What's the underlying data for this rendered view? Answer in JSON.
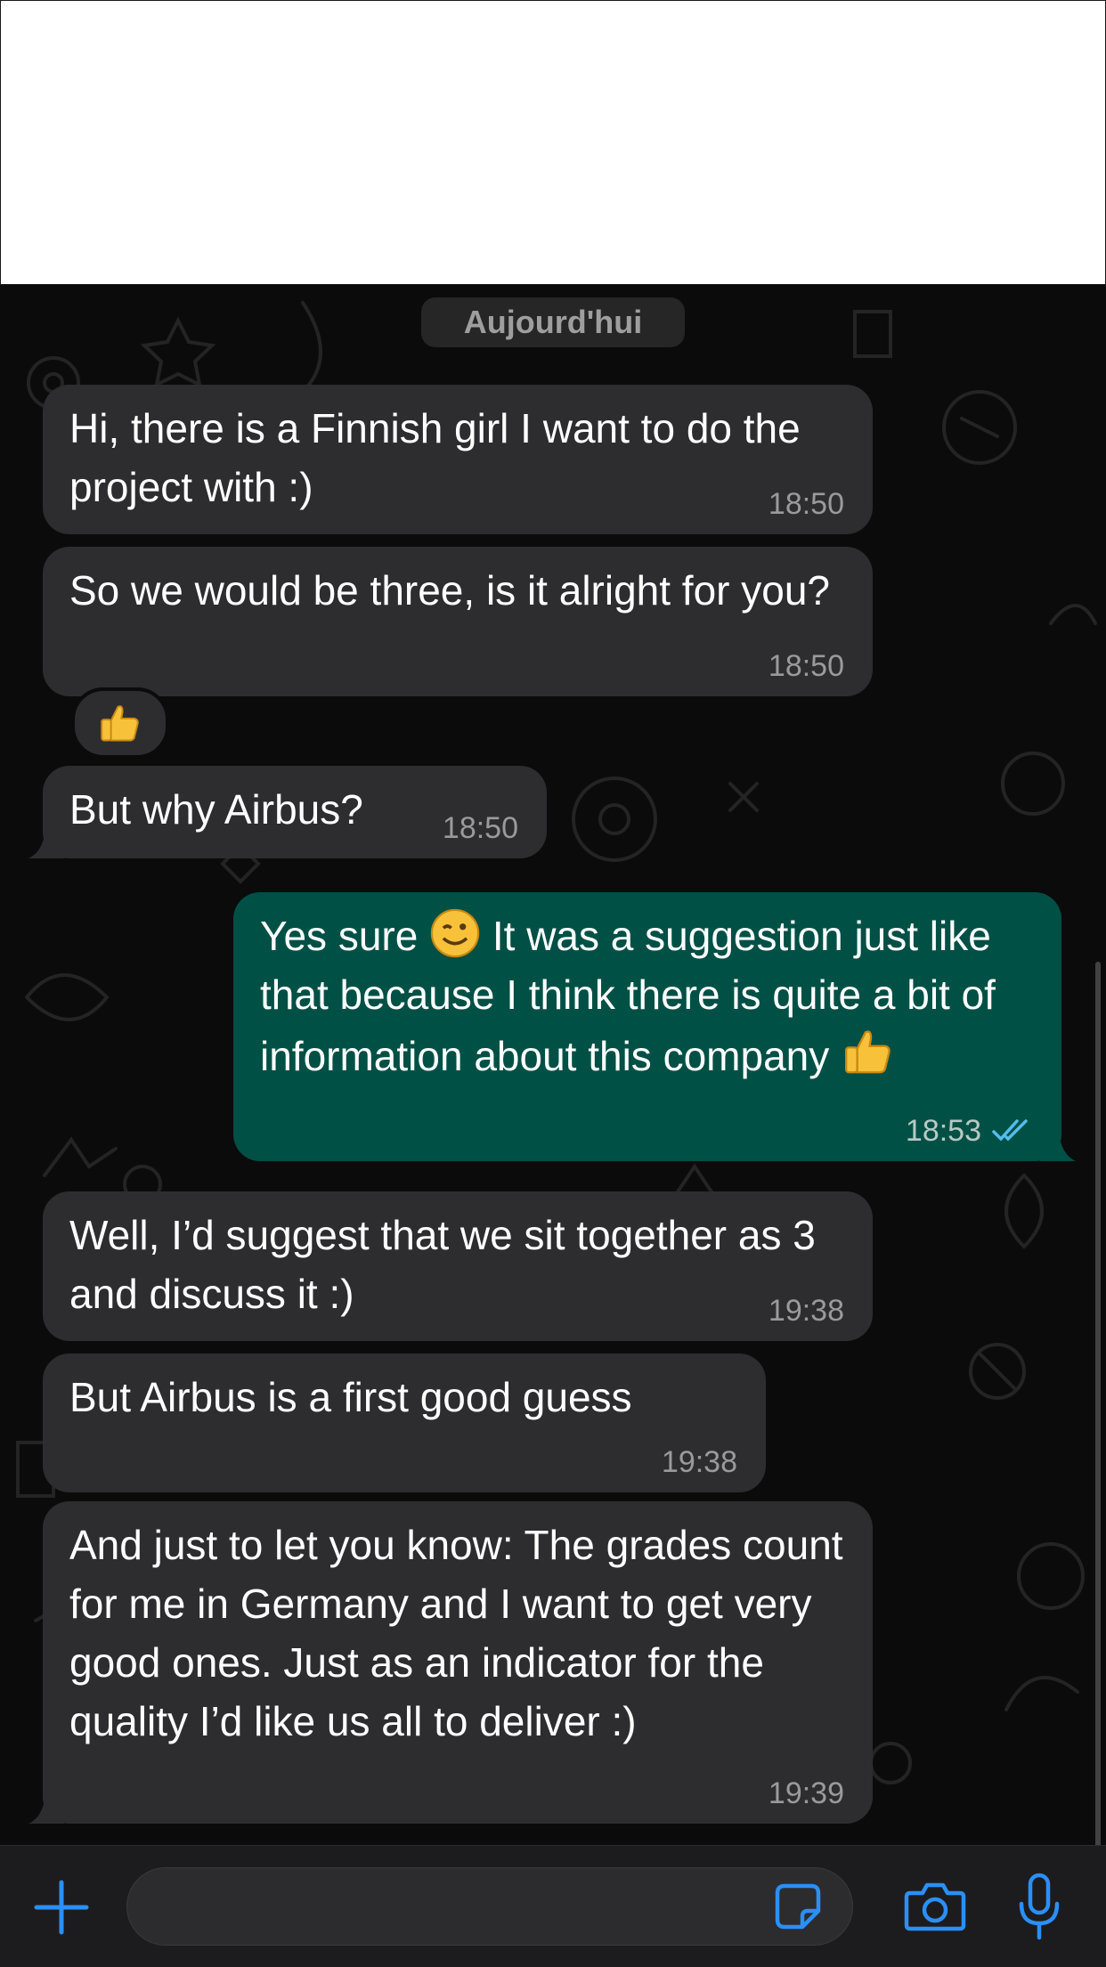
{
  "date_separator": "Aujourd'hui",
  "messages": [
    {
      "direction": "incoming",
      "text": "Hi, there is a Finnish girl I want to do the project with :)",
      "time": "18:50"
    },
    {
      "direction": "incoming",
      "text": "So we would be three, is it alright for you?",
      "time": "18:50",
      "reaction": "thumbs-up"
    },
    {
      "direction": "incoming",
      "text": "But why Airbus?",
      "time": "18:50"
    },
    {
      "direction": "outgoing",
      "text_before_emoji": "Yes sure",
      "emoji_1": "winking-face",
      "text_after_emoji": "It was a suggestion just like that because I think there is quite a bit of information about this company",
      "emoji_2": "thumbs-up",
      "time": "18:53",
      "status": "read"
    },
    {
      "direction": "incoming",
      "text": "Well, I’d suggest that we sit together as 3 and discuss it :)",
      "time": "19:38"
    },
    {
      "direction": "incoming",
      "text": "But Airbus is a first good guess",
      "time": "19:38"
    },
    {
      "direction": "incoming",
      "text": "And just to let you know: The grades count for me in Germany and I want to get very good ones. Just as an indicator for the quality I’d like us all to deliver :)",
      "time": "19:39"
    }
  ],
  "composer": {
    "placeholder": "",
    "value": ""
  },
  "colors": {
    "incoming_bubble": "#2d2d2f",
    "outgoing_bubble": "#005046",
    "accent": "#2a8ff7",
    "read_ticks": "#53bdeb",
    "background": "#0b0b0b"
  },
  "icons": {
    "attach": "plus-icon",
    "sticker": "sticker-icon",
    "camera": "camera-icon",
    "voice": "microphone-icon"
  }
}
